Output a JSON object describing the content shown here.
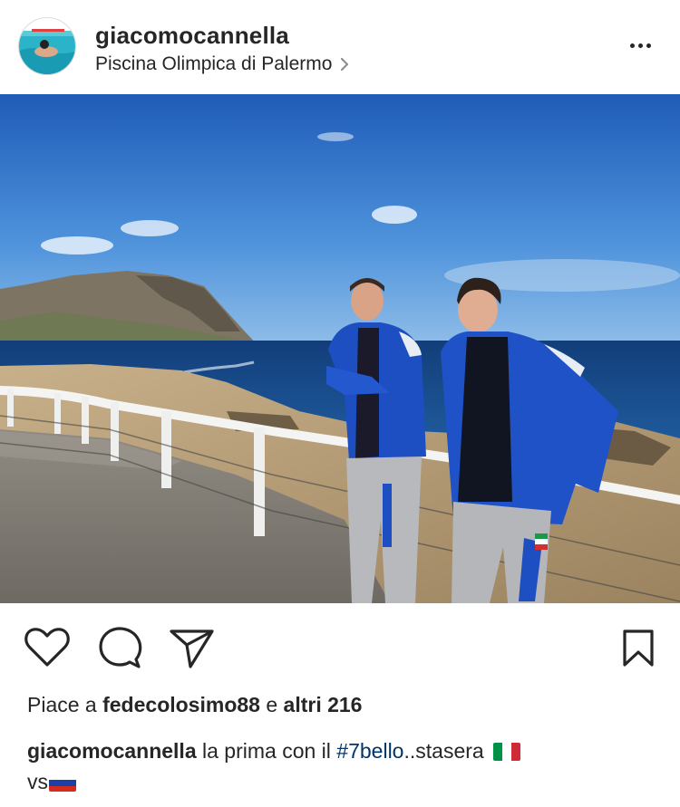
{
  "post": {
    "username": "giacomocannella",
    "location": "Piscina Olimpica di Palermo",
    "likes": {
      "prefix": "Piace a",
      "user": "fedecolosimo88",
      "conjunction": "e",
      "others": "altri 216"
    },
    "caption": {
      "username": "giacomocannella",
      "text_before": "la prima con il",
      "hashtag": "#7bello",
      "text_after": "..stasera",
      "line2": "vs"
    }
  },
  "icons": {
    "more": "more-horizontal-icon",
    "like": "heart-icon",
    "comment": "comment-icon",
    "share": "send-icon",
    "save": "bookmark-icon",
    "location_chevron": "chevron-right-icon",
    "flag_italy": "italy-flag-icon",
    "flag_russia": "russia-flag-icon"
  },
  "colors": {
    "text": "#262626",
    "hashtag": "#003569",
    "divider": "#dbdbdb"
  }
}
